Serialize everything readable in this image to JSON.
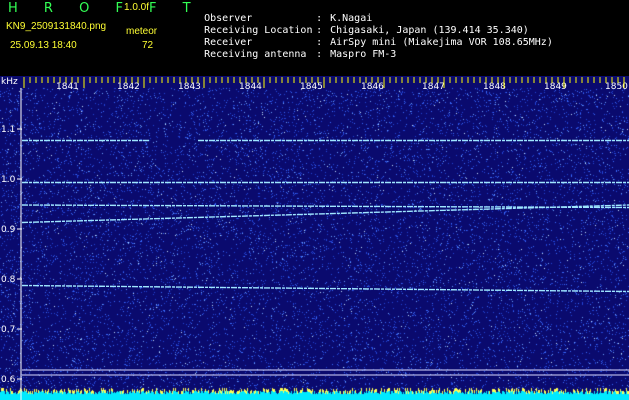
{
  "header": {
    "app_title": "H R O F F T",
    "version": "1.0.0f",
    "file_name": "KN9_2509131840.png",
    "mode": "meteor",
    "datetime": "25.09.13 18:40",
    "count": "72",
    "info": [
      {
        "label": "Observer",
        "value": "K.Nagai"
      },
      {
        "label": "Receiving Location",
        "value": "Chigasaki, Japan (139.414 35.340)"
      },
      {
        "label": "Receiver",
        "value": "AirSpy mini (Miakejima VOR 108.65MHz)"
      },
      {
        "label": "Receiving antenna",
        "value": "Maspro FM-3"
      }
    ]
  },
  "spectrogram": {
    "y_unit": "kHz",
    "y_ticks": [
      1.1,
      1.0,
      0.9,
      0.8,
      0.7,
      0.6
    ],
    "y_tick_labels": [
      "1.1",
      "1.0",
      "0.9",
      "0.8",
      "0.7",
      "0.6"
    ],
    "time_labels": [
      "1841",
      "1842",
      "1843",
      "1844",
      "1845",
      "1846",
      "1847",
      "1848",
      "1849",
      "1850"
    ],
    "traces_khz": [
      {
        "start": 1.077,
        "end": 1.077,
        "gap_from": 0.21,
        "gap_to": 0.29
      },
      {
        "start": 0.993,
        "end": 0.993
      },
      {
        "start": 0.948,
        "end": 0.943
      },
      {
        "start": 0.913,
        "end": 0.948
      },
      {
        "start": 0.787,
        "end": 0.775
      }
    ],
    "reference_lines_khz": [
      0.618,
      0.608
    ],
    "colors": {
      "background": "#0a0a6e",
      "noise": "#3a6cff",
      "trace": "#9fe6ff",
      "tick": "#ffff00",
      "bottom_band": "#00eaff"
    }
  }
}
